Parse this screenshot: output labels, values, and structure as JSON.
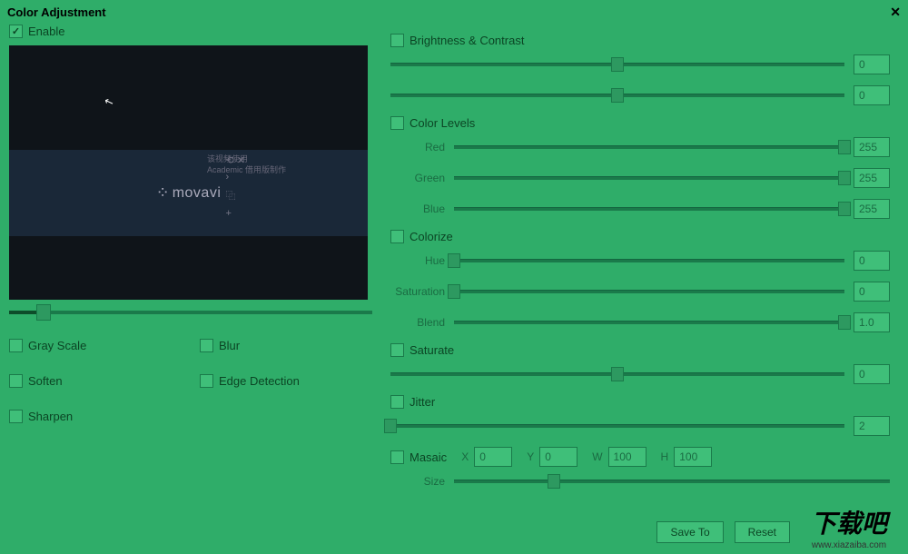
{
  "title": "Color Adjustment",
  "enable_label": "Enable",
  "enable_checked": true,
  "preview": {
    "brand": "movavi",
    "cursor": "↖",
    "text1": "该视频使用",
    "text2": "Academic 借用版制作"
  },
  "left_options": {
    "gray_scale": "Gray Scale",
    "soften": "Soften",
    "sharpen": "Sharpen",
    "blur": "Blur",
    "edge_detection": "Edge Detection"
  },
  "sections": {
    "brightness_contrast": {
      "label": "Brightness & Contrast",
      "sliders": [
        {
          "value": "0",
          "pos": 50
        },
        {
          "value": "0",
          "pos": 50
        }
      ]
    },
    "color_levels": {
      "label": "Color Levels",
      "red_label": "Red",
      "red_value": "255",
      "green_label": "Green",
      "green_value": "255",
      "blue_label": "Blue",
      "blue_value": "255"
    },
    "colorize": {
      "label": "Colorize",
      "hue_label": "Hue",
      "hue_value": "0",
      "saturation_label": "Saturation",
      "saturation_value": "0",
      "blend_label": "Blend",
      "blend_value": "1.0"
    },
    "saturate": {
      "label": "Saturate",
      "value": "0"
    },
    "jitter": {
      "label": "Jitter",
      "value": "2"
    },
    "mosaic": {
      "label": "Masaic",
      "x_label": "X",
      "x_value": "0",
      "y_label": "Y",
      "y_value": "0",
      "w_label": "W",
      "w_value": "100",
      "h_label": "H",
      "h_value": "100",
      "size_label": "Size"
    }
  },
  "buttons": {
    "save_to": "Save To",
    "reset": "Reset"
  },
  "watermark": {
    "text": "下载吧",
    "url": "www.xiazaiba.com"
  }
}
